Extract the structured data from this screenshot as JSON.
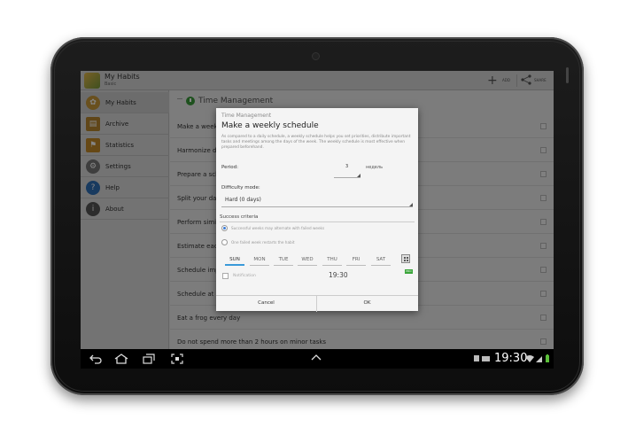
{
  "app": {
    "title": "My Habits",
    "subtitle": "Basic"
  },
  "actionbar": {
    "add_label": "ADD",
    "share_label": "SHARE"
  },
  "sidebar": {
    "items": [
      {
        "label": "My Habits",
        "icon": "habits-icon",
        "color": "#c99a3a"
      },
      {
        "label": "Archive",
        "icon": "archive-icon",
        "color": "#b8862e"
      },
      {
        "label": "Statistics",
        "icon": "flag-icon",
        "color": "#c48a2a"
      },
      {
        "label": "Settings",
        "icon": "gear-icon",
        "color": "#777777"
      },
      {
        "label": "Help",
        "icon": "help-icon",
        "color": "#2f6fb7"
      },
      {
        "label": "About",
        "icon": "info-icon",
        "color": "#555555"
      }
    ]
  },
  "main": {
    "section_title": "Time Management",
    "tasks": [
      "Make a weekly schedule",
      "Harmonize daily schedule",
      "Prepare a schedule",
      "Split your day",
      "Perform similar tasks",
      "Estimate each task",
      "Schedule important tasks",
      "Schedule at least",
      "Eat a frog every day",
      "Do not spend more than 2 hours on minor tasks"
    ]
  },
  "dialog": {
    "category": "Time Management",
    "title": "Make a weekly schedule",
    "description": "As compared to a daily schedule, a weekly schedule helps you set priorities, distribute important tasks and meetings among the days of the week. The weekly schedule is most effective when prepared beforehand.",
    "period_label": "Period:",
    "period_value": "3",
    "period_unit": "недель",
    "difficulty_label": "Difficulty mode:",
    "difficulty_value": "Hard (0 days)",
    "criteria_label": "Success criteria",
    "criteria_options": [
      "Successful weeks may alternate with failed weeks",
      "One failed week restarts the habit"
    ],
    "days": [
      "SUN",
      "MON",
      "TUE",
      "WED",
      "THU",
      "FRI",
      "SAT"
    ],
    "selected_day": "SUN",
    "pro_badge": "PRO",
    "notification_label": "Notification",
    "notification_time": "19:30",
    "cancel_label": "Cancel",
    "ok_label": "OK"
  },
  "status": {
    "time": "19:30"
  },
  "colors": {
    "accent": "#3a9ad9",
    "section_icon": "#3a9c3a",
    "pro": "#3aa53a"
  }
}
